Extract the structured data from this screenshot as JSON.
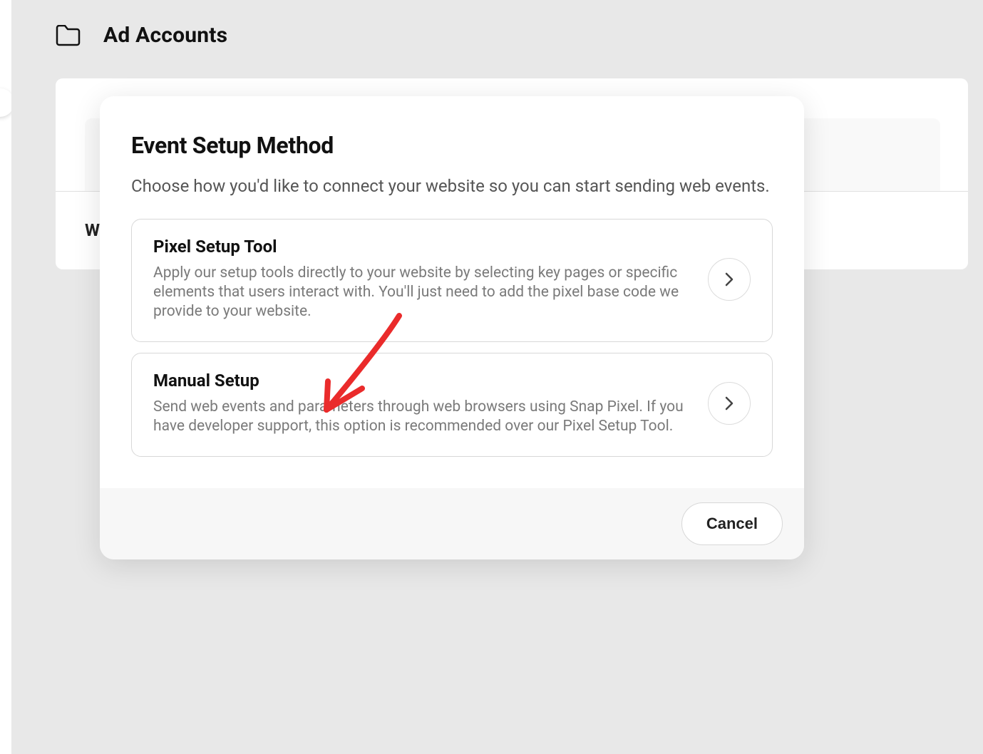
{
  "page": {
    "title": "Ad Accounts",
    "bg_label_fragment": "W"
  },
  "modal": {
    "title": "Event Setup Method",
    "subtitle": "Choose how you'd like to connect your website so you can start sending web events.",
    "options": [
      {
        "title": "Pixel Setup Tool",
        "description": "Apply our setup tools directly to your website by selecting key pages or specific elements that users interact with. You'll just need to add the pixel base code we provide to your website."
      },
      {
        "title": "Manual Setup",
        "description": "Send web events and parameters through web browsers using Snap Pixel. If you have developer support, this option is recommended over our Pixel Setup Tool."
      }
    ],
    "cancel_label": "Cancel"
  },
  "annotation": {
    "arrow_color": "#ea2b2b"
  }
}
